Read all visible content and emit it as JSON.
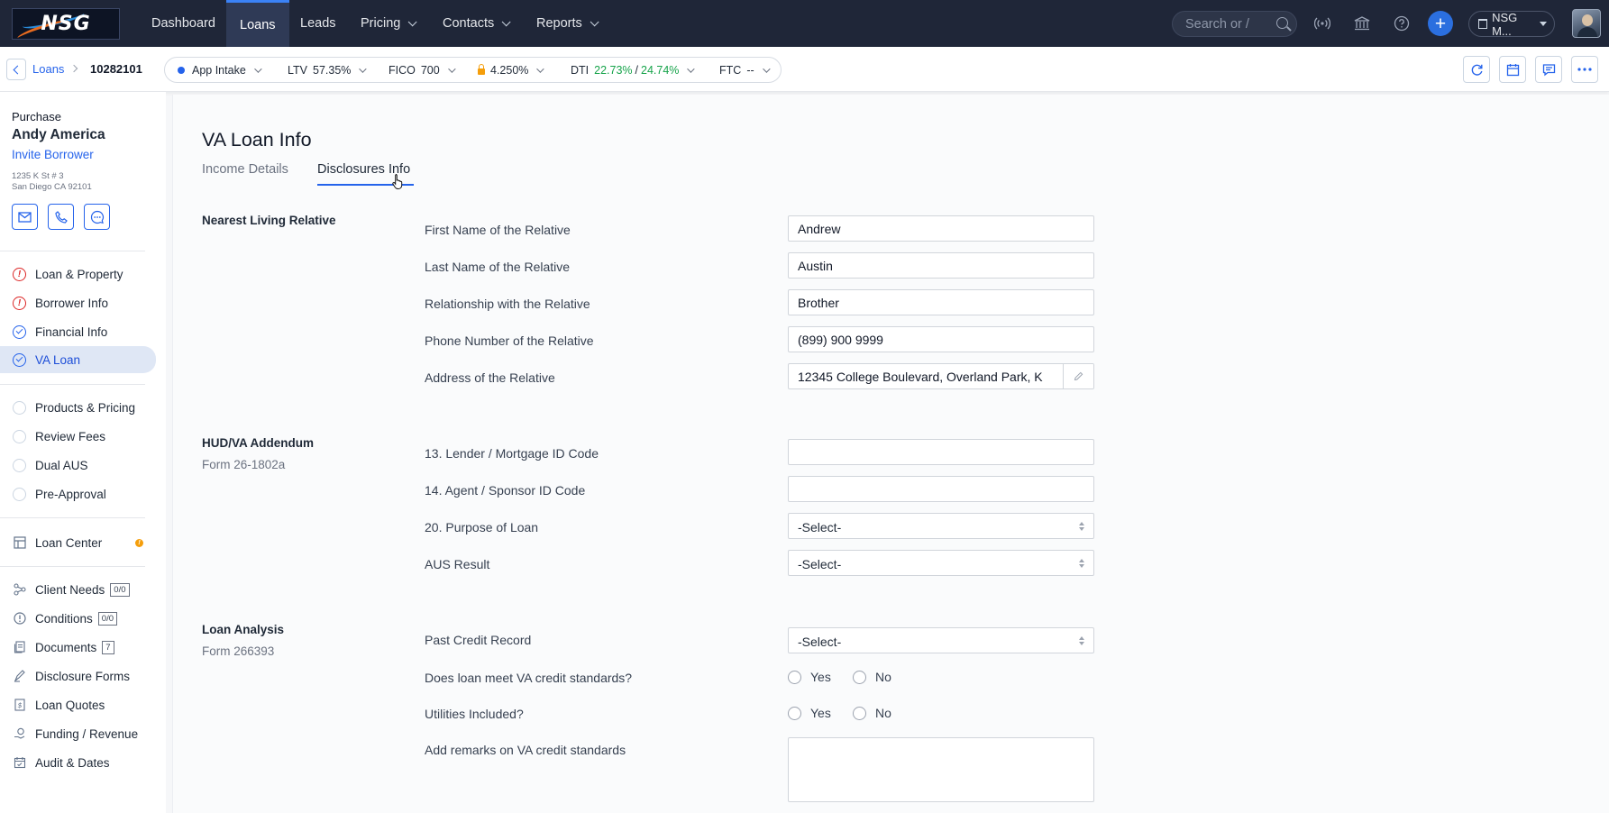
{
  "topnav": {
    "logo": "NSG",
    "items": [
      {
        "label": "Dashboard"
      },
      {
        "label": "Loans"
      },
      {
        "label": "Leads"
      },
      {
        "label": "Pricing"
      },
      {
        "label": "Contacts"
      },
      {
        "label": "Reports"
      }
    ],
    "search_placeholder": "Search or /",
    "org_label": "NSG M..."
  },
  "subbar": {
    "breadcrumb": {
      "parent": "Loans",
      "current": "10282101"
    },
    "status": "App Intake",
    "ltv": {
      "label": "LTV",
      "value": "57.35%"
    },
    "fico": {
      "label": "FICO",
      "value": "700"
    },
    "rate": "4.250%",
    "dti": {
      "label": "DTI",
      "front": "22.73%",
      "sep": "/",
      "back": "24.74%"
    },
    "ftc": {
      "label": "FTC",
      "value": "--"
    }
  },
  "sidebar": {
    "loan_type": "Purchase",
    "borrower_name": "Andy America",
    "invite": "Invite Borrower",
    "address_line1": "1235 K St # 3",
    "address_line2": "San Diego CA 92101",
    "steps": [
      {
        "label": "Loan & Property",
        "status": "error"
      },
      {
        "label": "Borrower Info",
        "status": "error"
      },
      {
        "label": "Financial Info",
        "status": "done"
      },
      {
        "label": "VA Loan",
        "status": "done"
      }
    ],
    "steps2": [
      {
        "label": "Products & Pricing"
      },
      {
        "label": "Review Fees"
      },
      {
        "label": "Dual AUS"
      },
      {
        "label": "Pre-Approval"
      }
    ],
    "loan_center": {
      "label": "Loan Center",
      "alert": "!"
    },
    "tools": [
      {
        "label": "Client Needs",
        "badge": "0/0"
      },
      {
        "label": "Conditions",
        "badge": "0/0"
      },
      {
        "label": "Documents",
        "badge": "7"
      },
      {
        "label": "Disclosure Forms"
      },
      {
        "label": "Loan Quotes"
      },
      {
        "label": "Funding / Revenue"
      },
      {
        "label": "Audit & Dates"
      }
    ]
  },
  "main": {
    "title": "VA Loan Info",
    "tabs": [
      {
        "label": "Income Details"
      },
      {
        "label": "Disclosures Info"
      }
    ],
    "relative": {
      "section": "Nearest Living Relative",
      "first_name_label": "First Name of the Relative",
      "first_name": "Andrew",
      "last_name_label": "Last Name of the Relative",
      "last_name": "Austin",
      "relationship_label": "Relationship with the Relative",
      "relationship": "Brother",
      "phone_label": "Phone Number of the Relative",
      "phone": "(899) 900 9999",
      "address_label": "Address of the Relative",
      "address": "12345 College Boulevard, Overland Park, K"
    },
    "hud": {
      "section": "HUD/VA Addendum",
      "form": "Form 26-1802a",
      "lender_label": "13. Lender / Mortgage ID Code",
      "lender": "",
      "agent_label": "14. Agent / Sponsor ID Code",
      "agent": "",
      "purpose_label": "20. Purpose of Loan",
      "purpose": "-Select-",
      "aus_label": "AUS Result",
      "aus": "-Select-"
    },
    "analysis": {
      "section": "Loan Analysis",
      "form": "Form 266393",
      "credit_label": "Past Credit Record",
      "credit": "-Select-",
      "meets_label": "Does loan meet VA credit standards?",
      "utilities_label": "Utilities Included?",
      "yes": "Yes",
      "no": "No",
      "remarks_label": "Add remarks on VA credit standards"
    }
  }
}
